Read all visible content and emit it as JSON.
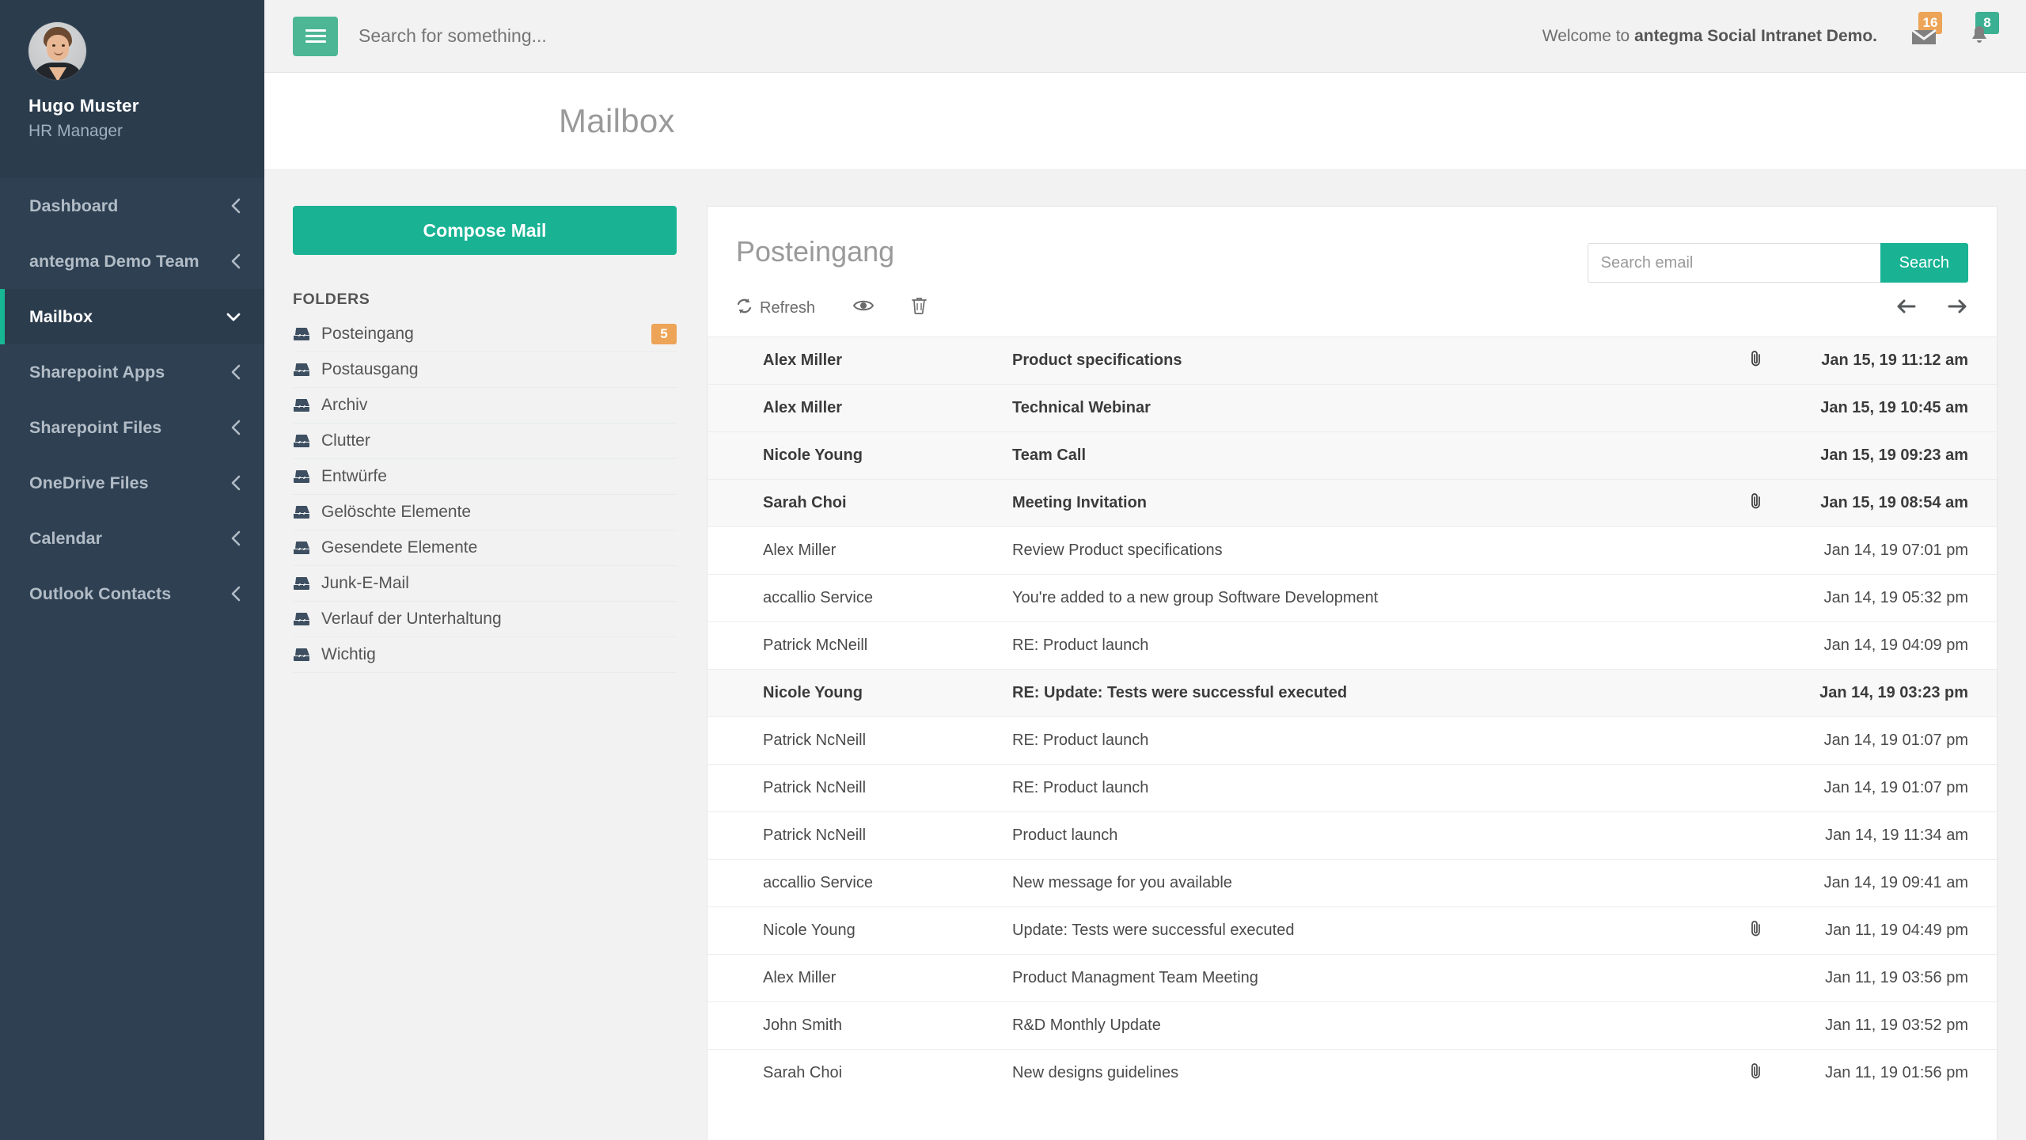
{
  "sidebar": {
    "profile": {
      "name": "Hugo Muster",
      "role": "HR Manager",
      "avatar_icon": "user-avatar"
    },
    "items": [
      {
        "label": "Dashboard",
        "chevron": "chevron-left-icon",
        "active": false
      },
      {
        "label": "antegma Demo Team",
        "chevron": "chevron-left-icon",
        "active": false
      },
      {
        "label": "Mailbox",
        "chevron": "chevron-down-icon",
        "active": true
      },
      {
        "label": "Sharepoint Apps",
        "chevron": "chevron-left-icon",
        "active": false
      },
      {
        "label": "Sharepoint Files",
        "chevron": "chevron-left-icon",
        "active": false
      },
      {
        "label": "OneDrive Files",
        "chevron": "chevron-left-icon",
        "active": false
      },
      {
        "label": "Calendar",
        "chevron": "chevron-left-icon",
        "active": false
      },
      {
        "label": "Outlook Contacts",
        "chevron": "chevron-left-icon",
        "active": false
      }
    ]
  },
  "topbar": {
    "menu_icon": "hamburger-menu-icon",
    "search_placeholder": "Search for something...",
    "search_value": "",
    "welcome_prefix": "Welcome to ",
    "welcome_brand": "antegma Social Intranet Demo.",
    "messages": {
      "icon": "envelope-icon",
      "count": "16",
      "color": "#eda457"
    },
    "notifications": {
      "icon": "bell-icon",
      "count": "8",
      "color": "#3bb092"
    }
  },
  "page": {
    "title": "Mailbox"
  },
  "mail_sidebar": {
    "compose_label": "Compose Mail",
    "folders_label": "FOLDERS",
    "folders": [
      {
        "name": "Posteingang",
        "icon": "inbox-icon",
        "badge": "5"
      },
      {
        "name": "Postausgang",
        "icon": "inbox-icon",
        "badge": ""
      },
      {
        "name": "Archiv",
        "icon": "inbox-icon",
        "badge": ""
      },
      {
        "name": "Clutter",
        "icon": "inbox-icon",
        "badge": ""
      },
      {
        "name": "Entwürfe",
        "icon": "inbox-icon",
        "badge": ""
      },
      {
        "name": "Gelöschte Elemente",
        "icon": "inbox-icon",
        "badge": ""
      },
      {
        "name": "Gesendete Elemente",
        "icon": "inbox-icon",
        "badge": ""
      },
      {
        "name": "Junk-E-Mail",
        "icon": "inbox-icon",
        "badge": ""
      },
      {
        "name": "Verlauf der Unterhaltung",
        "icon": "inbox-icon",
        "badge": ""
      },
      {
        "name": "Wichtig",
        "icon": "inbox-icon",
        "badge": ""
      }
    ]
  },
  "mail_panel": {
    "title": "Posteingang",
    "search_placeholder": "Search email",
    "search_value": "",
    "search_button": "Search",
    "toolbar": {
      "refresh_label": "Refresh",
      "refresh_icon": "refresh-icon",
      "read_icon": "eye-icon",
      "delete_icon": "trash-icon",
      "prev_icon": "arrow-left-icon",
      "next_icon": "arrow-right-icon"
    },
    "rows": [
      {
        "sender": "Alex Miller",
        "subject": "Product specifications",
        "attachment": true,
        "date": "Jan 15, 19 11:12 am",
        "unread": true
      },
      {
        "sender": "Alex Miller",
        "subject": "Technical Webinar",
        "attachment": false,
        "date": "Jan 15, 19 10:45 am",
        "unread": true
      },
      {
        "sender": "Nicole Young",
        "subject": "Team Call",
        "attachment": false,
        "date": "Jan 15, 19 09:23 am",
        "unread": true
      },
      {
        "sender": "Sarah Choi",
        "subject": "Meeting Invitation",
        "attachment": true,
        "date": "Jan 15, 19 08:54 am",
        "unread": true
      },
      {
        "sender": "Alex Miller",
        "subject": "Review Product specifications",
        "attachment": false,
        "date": "Jan 14, 19 07:01 pm",
        "unread": false
      },
      {
        "sender": "accallio Service",
        "subject": "You're added to a new group Software Development",
        "attachment": false,
        "date": "Jan 14, 19 05:32 pm",
        "unread": false
      },
      {
        "sender": "Patrick McNeill",
        "subject": "RE: Product launch",
        "attachment": false,
        "date": "Jan 14, 19 04:09 pm",
        "unread": false
      },
      {
        "sender": "Nicole Young",
        "subject": "RE: Update: Tests were successful executed",
        "attachment": false,
        "date": "Jan 14, 19 03:23 pm",
        "unread": true
      },
      {
        "sender": "Patrick NcNeill",
        "subject": "RE: Product launch",
        "attachment": false,
        "date": "Jan 14, 19 01:07 pm",
        "unread": false
      },
      {
        "sender": "Patrick NcNeill",
        "subject": "RE: Product launch",
        "attachment": false,
        "date": "Jan 14, 19 01:07 pm",
        "unread": false
      },
      {
        "sender": "Patrick NcNeill",
        "subject": "Product launch",
        "attachment": false,
        "date": "Jan 14, 19 11:34 am",
        "unread": false
      },
      {
        "sender": "accallio Service",
        "subject": "New message for you available",
        "attachment": false,
        "date": "Jan 14, 19 09:41 am",
        "unread": false
      },
      {
        "sender": "Nicole Young",
        "subject": "Update: Tests were successful executed",
        "attachment": true,
        "date": "Jan 11, 19 04:49 pm",
        "unread": false
      },
      {
        "sender": "Alex Miller",
        "subject": "Product Managment Team Meeting",
        "attachment": false,
        "date": "Jan 11, 19 03:56 pm",
        "unread": false
      },
      {
        "sender": "John Smith",
        "subject": "R&D Monthly Update",
        "attachment": false,
        "date": "Jan 11, 19 03:52 pm",
        "unread": false
      },
      {
        "sender": "Sarah Choi",
        "subject": "New designs guidelines",
        "attachment": true,
        "date": "Jan 11, 19 01:56 pm",
        "unread": false
      }
    ]
  },
  "colors": {
    "sidebar_bg": "#2e4052",
    "sidebar_active": "#2b3c4d",
    "accent_green": "#19b394",
    "accent_orange": "#eda457",
    "badge_green": "#3bb092"
  }
}
